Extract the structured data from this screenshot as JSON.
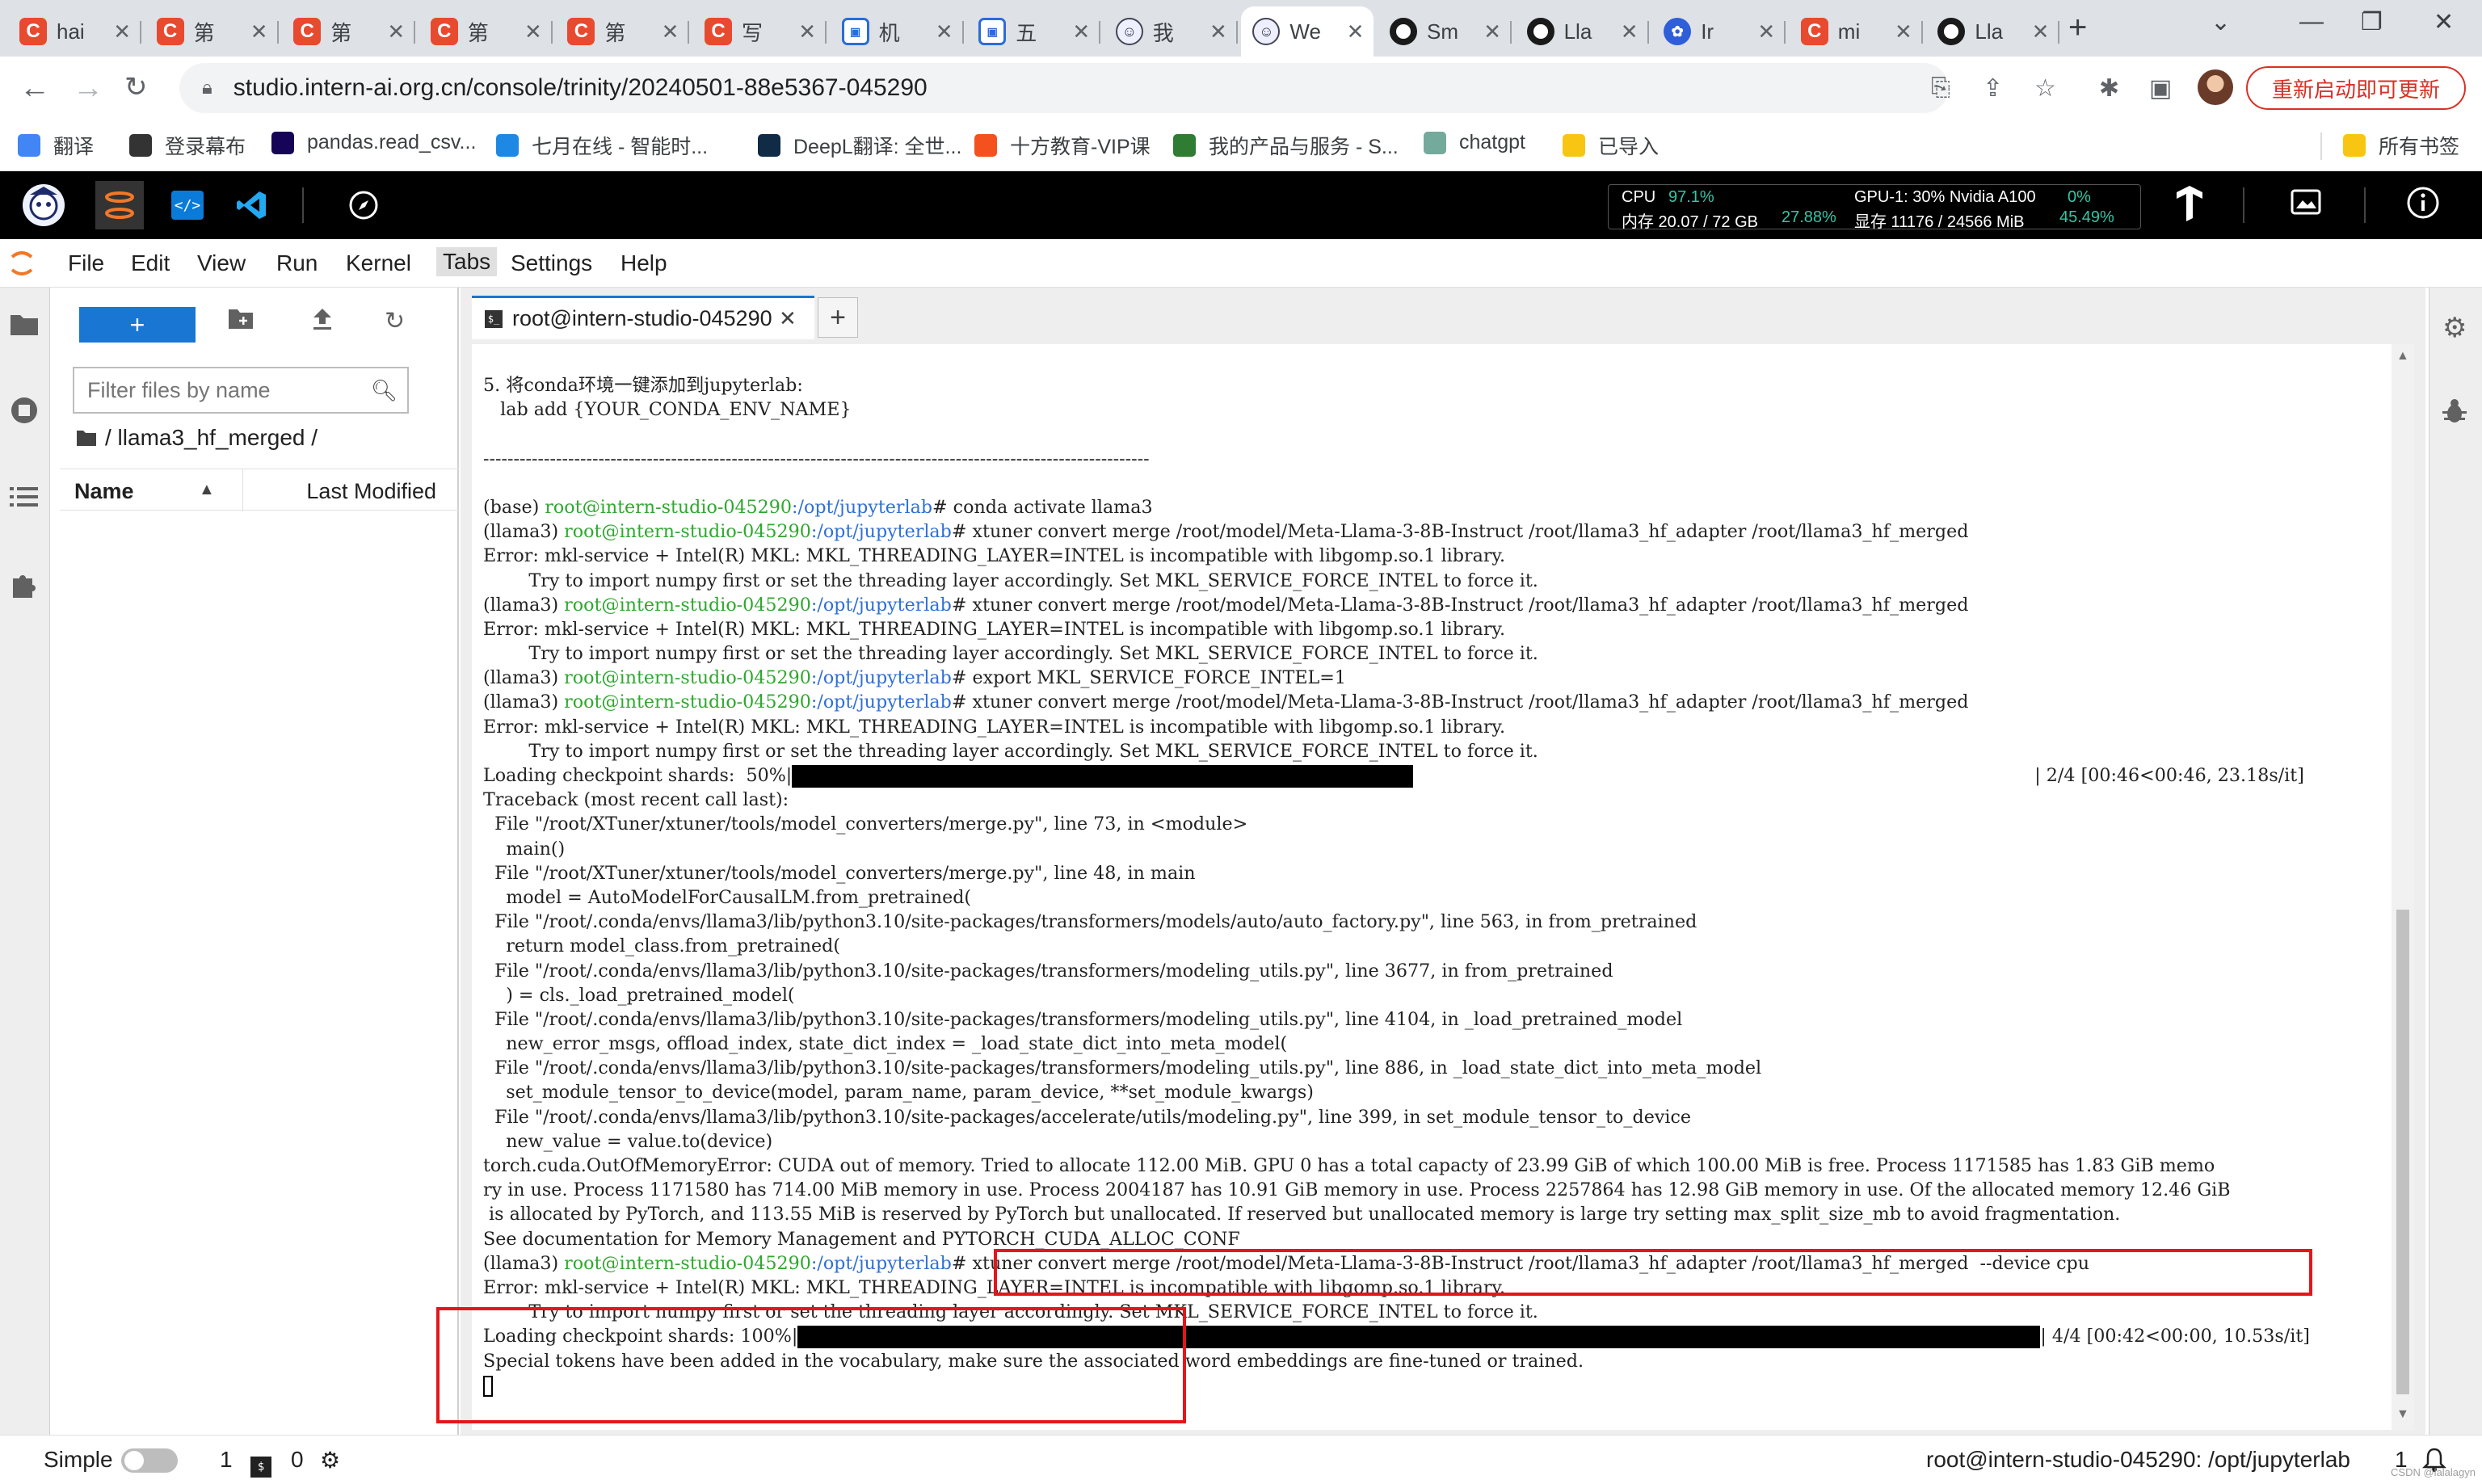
{
  "browser": {
    "tabs": [
      {
        "icon": "csdn-icon",
        "title": "hai"
      },
      {
        "icon": "csdn-icon",
        "title": "第"
      },
      {
        "icon": "csdn-icon",
        "title": "第"
      },
      {
        "icon": "csdn-icon",
        "title": "第"
      },
      {
        "icon": "csdn-icon",
        "title": "第"
      },
      {
        "icon": "csdn-icon",
        "title": "写"
      },
      {
        "icon": "calendar-icon",
        "title": "机"
      },
      {
        "icon": "calendar-icon",
        "title": "五"
      },
      {
        "icon": "robot-icon",
        "title": "我"
      },
      {
        "icon": "robot-icon",
        "title": "We",
        "active": true
      },
      {
        "icon": "github-icon",
        "title": "Sm"
      },
      {
        "icon": "github-icon",
        "title": "Lla"
      },
      {
        "icon": "paw-icon",
        "title": "Ir"
      },
      {
        "icon": "csdn-icon",
        "title": "mi"
      },
      {
        "icon": "github-icon",
        "title": "Lla"
      }
    ],
    "url": "studio.intern-ai.org.cn/console/trinity/20240501-88e5367-045290",
    "update_label": "重新启动即可更新",
    "bookmarks": [
      {
        "label": "翻译",
        "icon": "translate-icon",
        "color": "#4285f4"
      },
      {
        "label": "登录幕布",
        "icon": "mubu-icon",
        "color": "#333333"
      },
      {
        "label": "pandas.read_csv...",
        "icon": "pandas-icon",
        "color": "#150458"
      },
      {
        "label": "七月在线 - 智能时...",
        "icon": "julyedu-icon",
        "color": "#1e88e5"
      },
      {
        "label": "DeepL翻译: 全世...",
        "icon": "deepl-icon",
        "color": "#0f2b46"
      },
      {
        "label": "十方教育-VIP课",
        "icon": "shifang-icon",
        "color": "#f4511e"
      },
      {
        "label": "我的产品与服务 - S...",
        "icon": "check-icon",
        "color": "#2e7d32"
      },
      {
        "label": "chatgpt",
        "icon": "chatgpt-icon",
        "color": "#74aa9c"
      },
      {
        "label": "已导入",
        "icon": "folder-icon",
        "color": "#f9c513"
      }
    ],
    "all_bookmarks": "所有书签"
  },
  "studio": {
    "cpu_label": "CPU",
    "cpu_pct": "97.1%",
    "mem_label": "内存 20.07 / 72 GB",
    "mem_pct": "27.88%",
    "gpu_label": "GPU-1: 30% Nvidia A100",
    "gpu_pct": "0%",
    "vram_label": "显存 11176 / 24566 MiB",
    "vram_pct": "45.49%"
  },
  "menu": [
    "File",
    "Edit",
    "View",
    "Run",
    "Kernel",
    "Tabs",
    "Settings",
    "Help"
  ],
  "filebrowser": {
    "new_label": "+",
    "filter_placeholder": "Filter files by name",
    "breadcrumb": "/ llama3_hf_merged /",
    "col_name": "Name",
    "col_modified": "Last Modified"
  },
  "terminal_tab": "root@intern-studio-045290",
  "terminal": {
    "lines": [
      {
        "t": "5. 将conda环境一键添加到jupyterlab:"
      },
      {
        "t": "   lab add {YOUR_CONDA_ENV_NAME}"
      },
      {
        "t": ""
      },
      {
        "t": "--------------------------------------------------------------------------------------------------------------"
      },
      {
        "t": ""
      },
      {
        "env": "(base) ",
        "user": "root@intern-studio-045290",
        "path": ":/opt/jupyterlab",
        "cmd": "# conda activate llama3"
      },
      {
        "env": "(llama3) ",
        "user": "root@intern-studio-045290",
        "path": ":/opt/jupyterlab",
        "cmd": "# xtuner convert merge /root/model/Meta-Llama-3-8B-Instruct /root/llama3_hf_adapter /root/llama3_hf_merged"
      },
      {
        "t": "Error: mkl-service + Intel(R) MKL: MKL_THREADING_LAYER=INTEL is incompatible with libgomp.so.1 library."
      },
      {
        "t": "        Try to import numpy first or set the threading layer accordingly. Set MKL_SERVICE_FORCE_INTEL to force it."
      },
      {
        "env": "(llama3) ",
        "user": "root@intern-studio-045290",
        "path": ":/opt/jupyterlab",
        "cmd": "# xtuner convert merge /root/model/Meta-Llama-3-8B-Instruct /root/llama3_hf_adapter /root/llama3_hf_merged"
      },
      {
        "t": "Error: mkl-service + Intel(R) MKL: MKL_THREADING_LAYER=INTEL is incompatible with libgomp.so.1 library."
      },
      {
        "t": "        Try to import numpy first or set the threading layer accordingly. Set MKL_SERVICE_FORCE_INTEL to force it."
      },
      {
        "env": "(llama3) ",
        "user": "root@intern-studio-045290",
        "path": ":/opt/jupyterlab",
        "cmd": "# export MKL_SERVICE_FORCE_INTEL=1"
      },
      {
        "env": "(llama3) ",
        "user": "root@intern-studio-045290",
        "path": ":/opt/jupyterlab",
        "cmd": "# xtuner convert merge /root/model/Meta-Llama-3-8B-Instruct /root/llama3_hf_adapter /root/llama3_hf_merged"
      },
      {
        "t": "Error: mkl-service + Intel(R) MKL: MKL_THREADING_LAYER=INTEL is incompatible with libgomp.so.1 library."
      },
      {
        "t": "        Try to import numpy first or set the threading layer accordingly. Set MKL_SERVICE_FORCE_INTEL to force it."
      },
      {
        "pre": "Loading checkpoint shards:  50%|",
        "fill": 0.5,
        "post": "| 2/4 [00:46<00:46, 23.18s/it]"
      },
      {
        "t": "Traceback (most recent call last):"
      },
      {
        "t": "  File \"/root/XTuner/xtuner/tools/model_converters/merge.py\", line 73, in <module>"
      },
      {
        "t": "    main()"
      },
      {
        "t": "  File \"/root/XTuner/xtuner/tools/model_converters/merge.py\", line 48, in main"
      },
      {
        "t": "    model = AutoModelForCausalLM.from_pretrained("
      },
      {
        "t": "  File \"/root/.conda/envs/llama3/lib/python3.10/site-packages/transformers/models/auto/auto_factory.py\", line 563, in from_pretrained"
      },
      {
        "t": "    return model_class.from_pretrained("
      },
      {
        "t": "  File \"/root/.conda/envs/llama3/lib/python3.10/site-packages/transformers/modeling_utils.py\", line 3677, in from_pretrained"
      },
      {
        "t": "    ) = cls._load_pretrained_model("
      },
      {
        "t": "  File \"/root/.conda/envs/llama3/lib/python3.10/site-packages/transformers/modeling_utils.py\", line 4104, in _load_pretrained_model"
      },
      {
        "t": "    new_error_msgs, offload_index, state_dict_index = _load_state_dict_into_meta_model("
      },
      {
        "t": "  File \"/root/.conda/envs/llama3/lib/python3.10/site-packages/transformers/modeling_utils.py\", line 886, in _load_state_dict_into_meta_model"
      },
      {
        "t": "    set_module_tensor_to_device(model, param_name, param_device, **set_module_kwargs)"
      },
      {
        "t": "  File \"/root/.conda/envs/llama3/lib/python3.10/site-packages/accelerate/utils/modeling.py\", line 399, in set_module_tensor_to_device"
      },
      {
        "t": "    new_value = value.to(device)"
      },
      {
        "t": "torch.cuda.OutOfMemoryError: CUDA out of memory. Tried to allocate 112.00 MiB. GPU 0 has a total capacty of 23.99 GiB of which 100.00 MiB is free. Process 1171585 has 1.83 GiB memo"
      },
      {
        "t": "ry in use. Process 1171580 has 714.00 MiB memory in use. Process 2004187 has 10.91 GiB memory in use. Process 2257864 has 12.98 GiB memory in use. Of the allocated memory 12.46 GiB"
      },
      {
        "t": " is allocated by PyTorch, and 113.55 MiB is reserved by PyTorch but unallocated. If reserved but unallocated memory is large try setting max_split_size_mb to avoid fragmentation."
      },
      {
        "t": "See documentation for Memory Management and PYTORCH_CUDA_ALLOC_CONF"
      },
      {
        "env": "(llama3) ",
        "user": "root@intern-studio-045290",
        "path": ":/opt/jupyterlab",
        "cmd": "# xtuner convert merge /root/model/Meta-Llama-3-8B-Instruct /root/llama3_hf_adapter /root/llama3_hf_merged  --device cpu"
      },
      {
        "t": "Error: mkl-service + Intel(R) MKL: MKL_THREADING_LAYER=INTEL is incompatible with libgomp.so.1 library."
      },
      {
        "t": "        Try to import numpy first or set the threading layer accordingly. Set MKL_SERVICE_FORCE_INTEL to force it."
      },
      {
        "pre": "Loading checkpoint shards: 100%|",
        "fill": 1.0,
        "post": "| 4/4 [00:42<00:00, 10.53s/it]"
      },
      {
        "t": "Special tokens have been added in the vocabulary, make sure the associated word embeddings are fine-tuned or trained."
      },
      {
        "cursor": true
      }
    ]
  },
  "status": {
    "simple": "Simple",
    "count1": "1",
    "count2": "0",
    "right": "root@intern-studio-045290: /opt/jupyterlab",
    "right_count": "1",
    "watermark": "CSDN @lalalagyn"
  }
}
